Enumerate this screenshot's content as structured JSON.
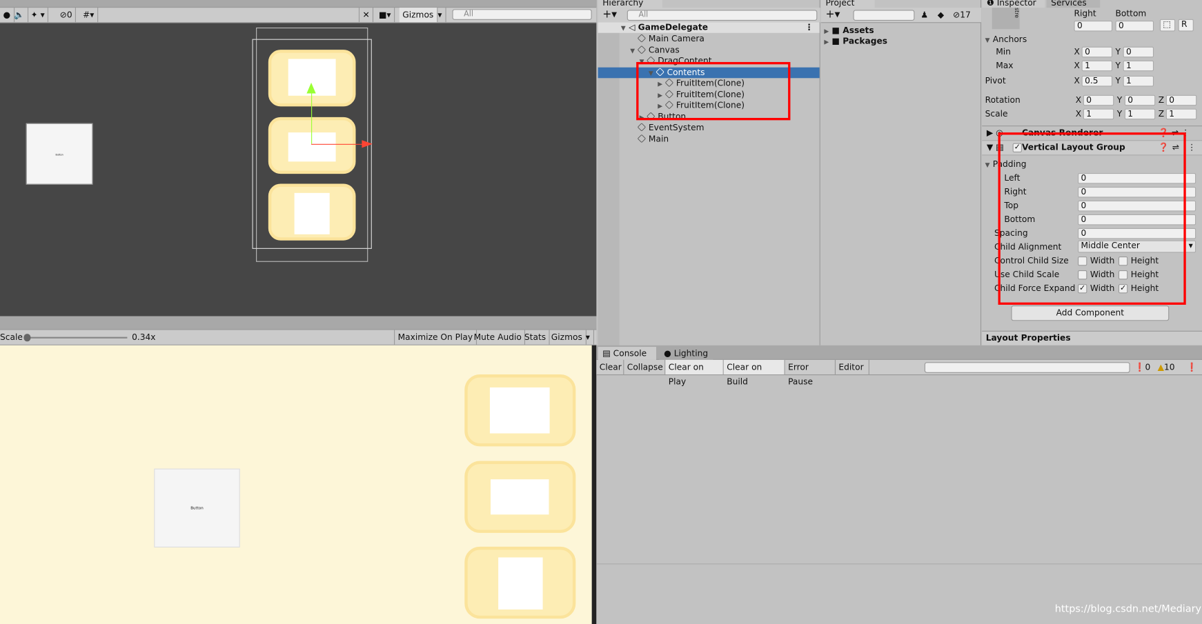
{
  "scene": {
    "toolbar": {
      "count": "0",
      "gizmos": "Gizmos",
      "search_placeholder": "All"
    }
  },
  "game": {
    "toolbar": {
      "scale_label": "Scale",
      "scale_value": "0.34x",
      "scale_fraction": 0.05,
      "maximize": "Maximize On Play",
      "mute": "Mute Audio",
      "stats": "Stats",
      "gizmos": "Gizmos"
    },
    "button_text": "Button"
  },
  "hierarchy": {
    "tab": "Hierarchy",
    "search_placeholder": "All",
    "scene": "GameDelegate",
    "items": [
      {
        "label": "Main Camera",
        "depth": 1
      },
      {
        "label": "Canvas",
        "depth": 1,
        "expanded": true
      },
      {
        "label": "DragContent",
        "depth": 2
      },
      {
        "label": "Contents",
        "depth": 3,
        "selected": true
      },
      {
        "label": "FruitItem(Clone)",
        "depth": 4
      },
      {
        "label": "FruitItem(Clone)",
        "depth": 4
      },
      {
        "label": "FruitItem(Clone)",
        "depth": 4
      },
      {
        "label": "Button",
        "depth": 2
      },
      {
        "label": "EventSystem",
        "depth": 1
      },
      {
        "label": "Main",
        "depth": 1
      }
    ]
  },
  "project": {
    "tab": "Project",
    "hidden_count": "17",
    "items": [
      "Assets",
      "Packages"
    ]
  },
  "inspector": {
    "tabs": [
      "Inspector",
      "Services"
    ],
    "stretch": "stre",
    "right_label": "Right",
    "bottom_label": "Bottom",
    "right": "0",
    "bottom": "0",
    "r_btn": "R",
    "anchors": "Anchors",
    "min": "Min",
    "max": "Max",
    "min_x": "0",
    "min_y": "0",
    "max_x": "1",
    "max_y": "1",
    "pivot": "Pivot",
    "pivot_x": "0.5",
    "pivot_y": "1",
    "rotation": "Rotation",
    "rot": [
      "0",
      "0",
      "0"
    ],
    "scale": "Scale",
    "scl": [
      "1",
      "1",
      "1"
    ],
    "x": "X",
    "y": "Y",
    "z": "Z",
    "canvas_renderer": "Canvas Renderer",
    "vlg": {
      "title": "Vertical Layout Group",
      "padding": "Padding",
      "fields": [
        {
          "label": "Left",
          "value": "0"
        },
        {
          "label": "Right",
          "value": "0"
        },
        {
          "label": "Top",
          "value": "0"
        },
        {
          "label": "Bottom",
          "value": "0"
        }
      ],
      "spacing_label": "Spacing",
      "spacing": "0",
      "child_alignment_label": "Child Alignment",
      "child_alignment": "Middle Center",
      "toggles": [
        {
          "label": "Control Child Size",
          "width": false,
          "height": false
        },
        {
          "label": "Use Child Scale",
          "width": false,
          "height": false
        },
        {
          "label": "Child Force Expand",
          "width": true,
          "height": true
        }
      ],
      "width": "Width",
      "height": "Height"
    },
    "add_component": "Add Component",
    "layout_properties": "Layout Properties"
  },
  "console": {
    "tabs": [
      "Console",
      "Lighting"
    ],
    "buttons": [
      "Clear",
      "Collapse",
      "Clear on Play",
      "Clear on Build",
      "Error Pause",
      "Editor"
    ],
    "errors": "0",
    "warnings": "10"
  },
  "watermark": "https://blog.csdn.net/Mediary"
}
